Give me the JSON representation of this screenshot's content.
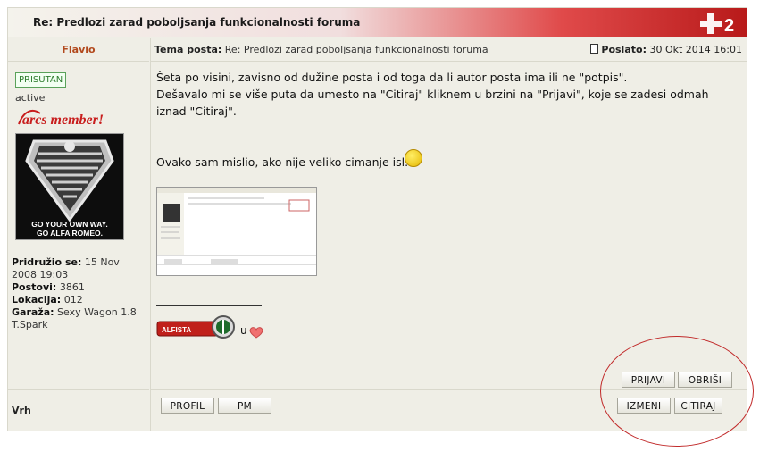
{
  "topic": {
    "title": "Re: Predlozi zarad poboljsanja funkcionalnosti foruma"
  },
  "author": {
    "name": "Flavio",
    "badge": "PRISUTAN",
    "status": "active",
    "member_logo_text": "arcs member!",
    "avatar_text": [
      "GO YOUR OWN WAY.",
      "GO ALFA ROMEO."
    ],
    "profile": [
      {
        "label": "Pridružio se:",
        "value": "15 Nov 2008 19:03"
      },
      {
        "label": "Postovi:",
        "value": "3861"
      },
      {
        "label": "Lokacija:",
        "value": "012"
      },
      {
        "label": "Garaža:",
        "value": "Sexy Wagon 1.8 T.Spark"
      }
    ]
  },
  "post_header": {
    "subject_label": "Tema posta:",
    "subject_value": "Re: Predlozi zarad poboljsanja funkcionalnosti foruma",
    "posted_label": "Poslato:",
    "posted_value": "30 Okt 2014 16:01"
  },
  "post_body": {
    "line1": "Šeta po visini, zavisno od dužine posta i od toga da li autor posta ima ili ne \"potpis\".",
    "line2": "Dešavalo mi se više puta da umesto na \"Citiraj\" kliknem u brzini na \"Prijavi\", koje se zadesi odmah iznad \"Citiraj\".",
    "line3": "Ovako sam mislio, ako nije veliko cimanje isl."
  },
  "signature": {
    "badge_text": "ALFISTA",
    "connector": "u"
  },
  "actions": {
    "report": "PRIJAVI",
    "delete": "OBRIŠI",
    "edit": "IZMENI",
    "quote": "CITIRAJ"
  },
  "footer": {
    "back_to_top": "Vrh",
    "profile": "PROFIL",
    "pm": "PM"
  },
  "colors": {
    "author": "#b2491d",
    "title_gradient_end": "#b81a1a",
    "highlight_oval": "#c12a2a"
  },
  "icons": [
    "forum-logo-icon",
    "doc-icon",
    "smiley-icon",
    "heart-icon",
    "alfa-badge-icon"
  ]
}
